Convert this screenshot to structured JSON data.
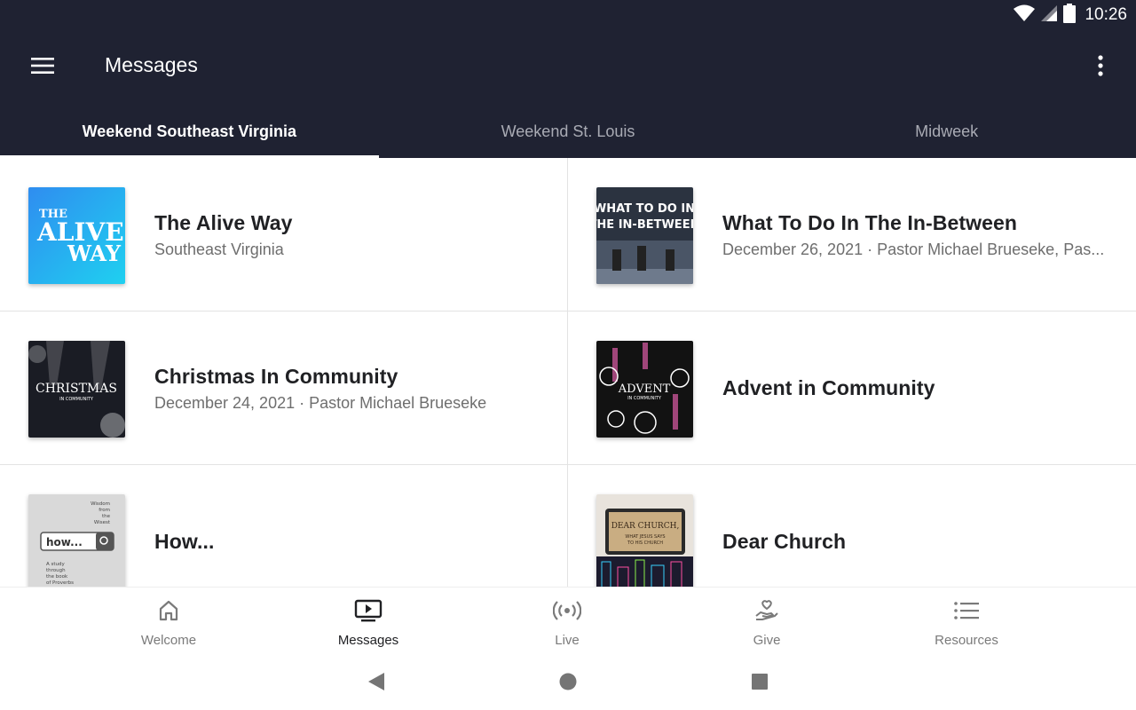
{
  "status_bar": {
    "time": "10:26",
    "icons": [
      "wifi-icon",
      "signal-icon",
      "battery-icon"
    ]
  },
  "app_bar": {
    "title": "Messages",
    "menu_icon": "hamburger-menu-icon",
    "overflow_icon": "more-vert-icon"
  },
  "tabs": [
    {
      "label": "Weekend Southeast Virginia",
      "active": true
    },
    {
      "label": "Weekend St. Louis",
      "active": false
    },
    {
      "label": "Midweek",
      "active": false
    }
  ],
  "items": [
    {
      "title": "The Alive Way",
      "subtitle": "Southeast Virginia",
      "thumb_text": [
        "THE",
        "ALIVE",
        "WAY"
      ]
    },
    {
      "title": "What To Do In The In-Between",
      "subtitle": "December 26, 2021 · Pastor Michael Brueseke, Pas...",
      "thumb_text": [
        "WHAT TO DO IN",
        "THE IN-BETWEEN"
      ]
    },
    {
      "title": "Christmas In Community",
      "subtitle": "December 24, 2021 · Pastor Michael Brueseke",
      "thumb_text": [
        "CHRISTMAS",
        "IN COMMUNITY"
      ]
    },
    {
      "title": "Advent in Community",
      "subtitle": "",
      "thumb_text": [
        "ADVENT",
        "IN COMMUNITY"
      ]
    },
    {
      "title": "How...",
      "subtitle": "",
      "thumb_text": [
        "Wisdom",
        "from",
        "the",
        "Wisest",
        "how...",
        "A study",
        "through",
        "the book",
        "of Proverbs"
      ]
    },
    {
      "title": "Dear Church",
      "subtitle": "",
      "thumb_text": [
        "DEAR CHURCH,",
        "WHAT JESUS SAYS",
        "TO HIS CHURCH"
      ]
    }
  ],
  "bottom_nav": [
    {
      "label": "Welcome",
      "icon": "home-icon",
      "active": false
    },
    {
      "label": "Messages",
      "icon": "video-player-icon",
      "active": true
    },
    {
      "label": "Live",
      "icon": "broadcast-icon",
      "active": false
    },
    {
      "label": "Give",
      "icon": "hand-heart-icon",
      "active": false
    },
    {
      "label": "Resources",
      "icon": "list-icon",
      "active": false
    }
  ],
  "colors": {
    "header_bg": "#1f2232",
    "active_text": "#ffffff",
    "inactive_tab": "#a9abb4",
    "title_text": "#202124",
    "subtitle_text": "#6e6e6e"
  }
}
